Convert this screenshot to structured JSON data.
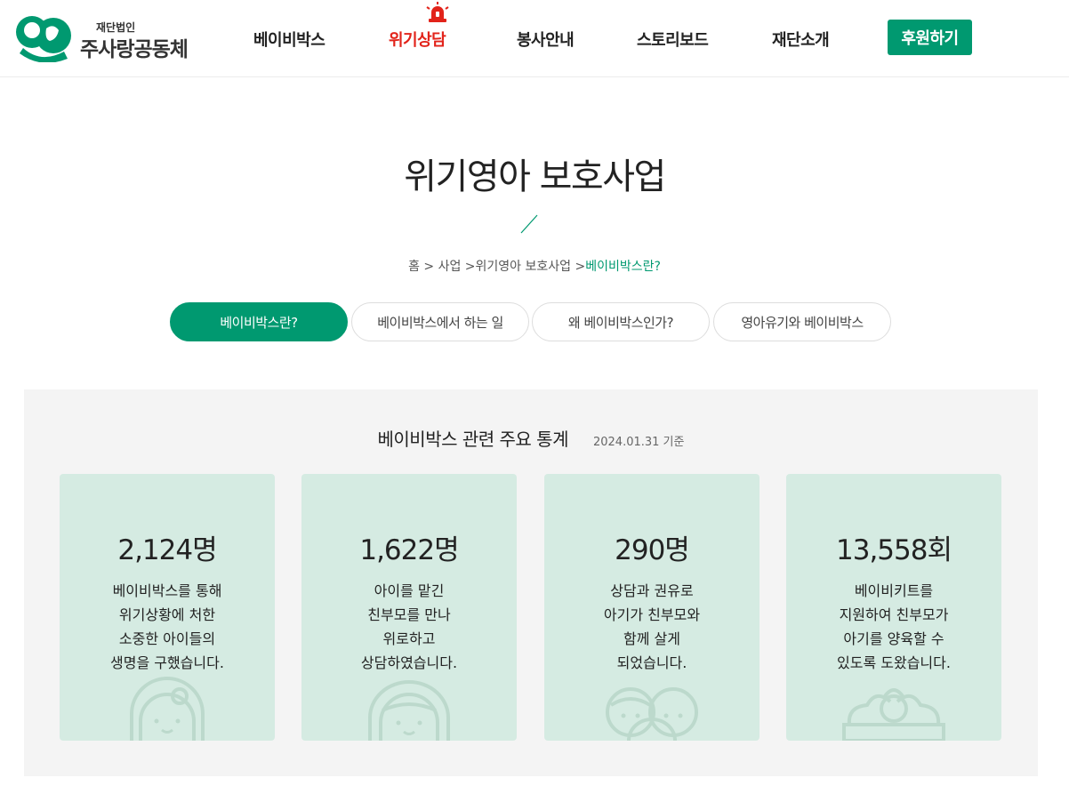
{
  "logo": {
    "subtitle": "재단법인",
    "name": "주사랑공동체"
  },
  "nav": {
    "items": [
      "베이비박스",
      "위기상담",
      "봉사안내",
      "스토리보드",
      "재단소개"
    ],
    "donate": "후원하기"
  },
  "page": {
    "title": "위기영아 보호사업"
  },
  "breadcrumb": {
    "path": "홈 > 사업 >위기영아 보호사업 >",
    "current": "베이비박스란?"
  },
  "tabs": [
    "베이비박스란?",
    "베이비박스에서 하는 일",
    "왜 베이비박스인가?",
    "영아유기와 베이비박스"
  ],
  "stats": {
    "title": "베이비박스 관련 주요 통계",
    "date": "2024.01.31 기준",
    "cards": [
      {
        "value": "2,124명",
        "lines": [
          "베이비박스를 통해",
          "위기상황에 처한",
          "소중한 아이들의",
          "생명을 구했습니다."
        ],
        "icon": "baby-icon"
      },
      {
        "value": "1,622명",
        "lines": [
          "아이를 맡긴",
          "친부모를 만나",
          "위로하고",
          "상담하였습니다."
        ],
        "icon": "mother-icon"
      },
      {
        "value": "290명",
        "lines": [
          "상담과 권유로",
          "아기가 친부모와",
          "함께 살게",
          "되었습니다."
        ],
        "icon": "family-icon"
      },
      {
        "value": "13,558회",
        "lines": [
          "베이비키트를",
          "지원하여 친부모가",
          "아기를 양육할 수",
          "있도록 도왔습니다."
        ],
        "icon": "baby-kit-icon"
      }
    ]
  },
  "colors": {
    "brand": "#009970",
    "alert": "#e2231a",
    "card_bg": "#d5ebe2",
    "section_bg": "#f4f4f4"
  }
}
